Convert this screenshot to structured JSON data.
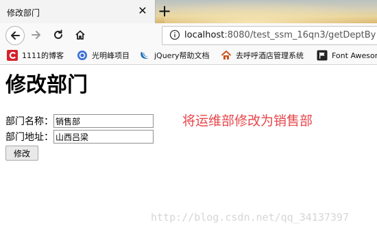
{
  "browser": {
    "tab_title": "修改部门",
    "tab_close": "✕",
    "new_tab": "+",
    "url_host": "localhost",
    "url_rest": ":8080/test_ssm_16qn3/getDeptBy",
    "icons": [
      "back-arrow-icon",
      "forward-arrow-icon",
      "reload-icon",
      "home-icon",
      "info-icon"
    ]
  },
  "bookmarks": [
    {
      "label": "1111的博客",
      "icon": "csdn-c-icon",
      "color": "#d6212a"
    },
    {
      "label": "光明峰项目",
      "icon": "blue-circle-icon",
      "color": "#3b6fd6"
    },
    {
      "label": "jQuery帮助文档",
      "icon": "jquery-icon",
      "color": "#1c6fb6"
    },
    {
      "label": "去呼呼酒店管理系统",
      "icon": "house-icon",
      "color": "#c9521d"
    },
    {
      "label": "Font Awesome",
      "icon": "flag-icon",
      "color": "#222222"
    }
  ],
  "page": {
    "title": "修改部门",
    "fields": [
      {
        "label": "部门名称：",
        "value": "销售部"
      },
      {
        "label": "部门地址：",
        "value": "山西吕梁"
      }
    ],
    "submit_label": "修改",
    "annotation": "将运维部修改为销售部",
    "annotation_color": "#e8454a",
    "watermark": "http://blog.csdn.net/qq_34137397"
  }
}
